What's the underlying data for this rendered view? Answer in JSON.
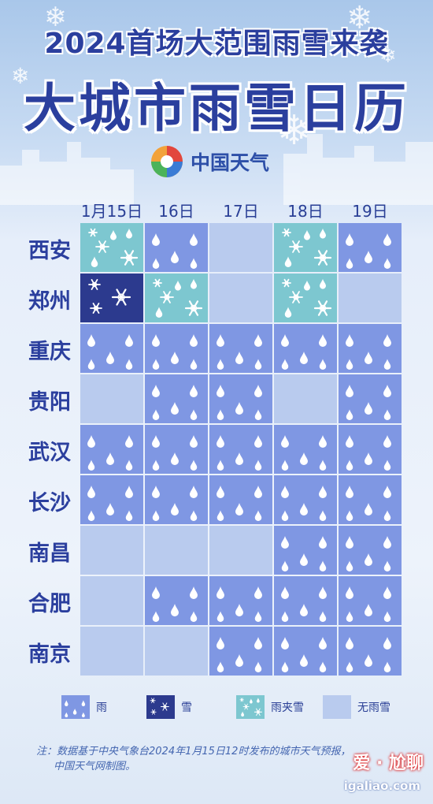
{
  "header": {
    "title_line1": "2024首场大范围雨雪来袭",
    "title_line2": "大城市雨雪日历",
    "brand": "中国天气"
  },
  "chart_data": {
    "type": "table",
    "columns": [
      "1月15日",
      "16日",
      "17日",
      "18日",
      "19日"
    ],
    "cities": [
      "西安",
      "郑州",
      "重庆",
      "贵阳",
      "武汉",
      "长沙",
      "南昌",
      "合肥",
      "南京"
    ],
    "weather_codes": {
      "rain": "雨",
      "snow": "雪",
      "sleet": "雨夹雪",
      "none": "无雨雪"
    },
    "cells": [
      [
        "sleet",
        "rain",
        "none",
        "sleet",
        "rain"
      ],
      [
        "snow",
        "sleet",
        "none",
        "sleet",
        "none"
      ],
      [
        "rain",
        "rain",
        "rain",
        "rain",
        "rain"
      ],
      [
        "none",
        "rain",
        "rain",
        "none",
        "rain"
      ],
      [
        "rain",
        "rain",
        "rain",
        "rain",
        "rain"
      ],
      [
        "rain",
        "rain",
        "rain",
        "rain",
        "rain"
      ],
      [
        "none",
        "none",
        "none",
        "rain",
        "rain"
      ],
      [
        "none",
        "rain",
        "rain",
        "rain",
        "rain"
      ],
      [
        "none",
        "none",
        "rain",
        "rain",
        "rain"
      ]
    ],
    "colors": {
      "rain": "#7f97e3",
      "snow": "#2c3a8e",
      "sleet": "#7dc7d0",
      "none": "#b9cbee"
    }
  },
  "legend": [
    {
      "key": "rain",
      "label": "雨"
    },
    {
      "key": "snow",
      "label": "雪"
    },
    {
      "key": "sleet",
      "label": "雨夹雪"
    },
    {
      "key": "none",
      "label": "无雨雪"
    }
  ],
  "footer": {
    "note_line1": "注：数据基于中央气象台2024年1月15日12时发布的城市天气预报，",
    "note_line2": "中国天气网制图。",
    "watermark_title": "爱 · 尬聊",
    "watermark_url": "igaliao.com"
  }
}
